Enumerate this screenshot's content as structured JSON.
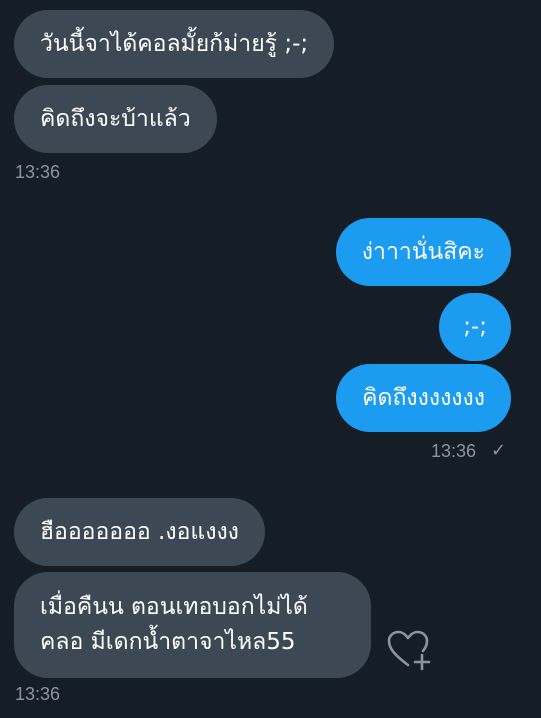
{
  "messages": [
    {
      "id": "m1",
      "direction": "incoming",
      "text": "วันนี้จาได้คอลมั้ยก้ม่ายรู้ ;-;"
    },
    {
      "id": "m2",
      "direction": "incoming",
      "text": "คิดถึงจะบ้าแล้ว"
    },
    {
      "id": "m3",
      "direction": "outgoing",
      "text": "ง่าาานั่นสิคะ"
    },
    {
      "id": "m4",
      "direction": "outgoing",
      "text": ";-;"
    },
    {
      "id": "m5",
      "direction": "outgoing",
      "text": "คิดถึงงงงงงง"
    },
    {
      "id": "m6",
      "direction": "incoming",
      "text": "ฮือออออออ .งอแงงง"
    },
    {
      "id": "m7",
      "direction": "incoming",
      "line1": "เมื่อคืนน ตอนเทอบอกไม่ได้",
      "line2": "คลอ มีเดกน้ำตาจาไหล55"
    }
  ],
  "timestamps": {
    "group1": "13:36",
    "group2": "13:36",
    "group2_status": "✓",
    "group3": "13:36"
  },
  "colors": {
    "background": "#151E27",
    "incoming_bubble": "#3C4955",
    "outgoing_bubble": "#1C9CF0",
    "timestamp": "#8A959E"
  },
  "icons": {
    "like": "heart-plus-icon"
  }
}
